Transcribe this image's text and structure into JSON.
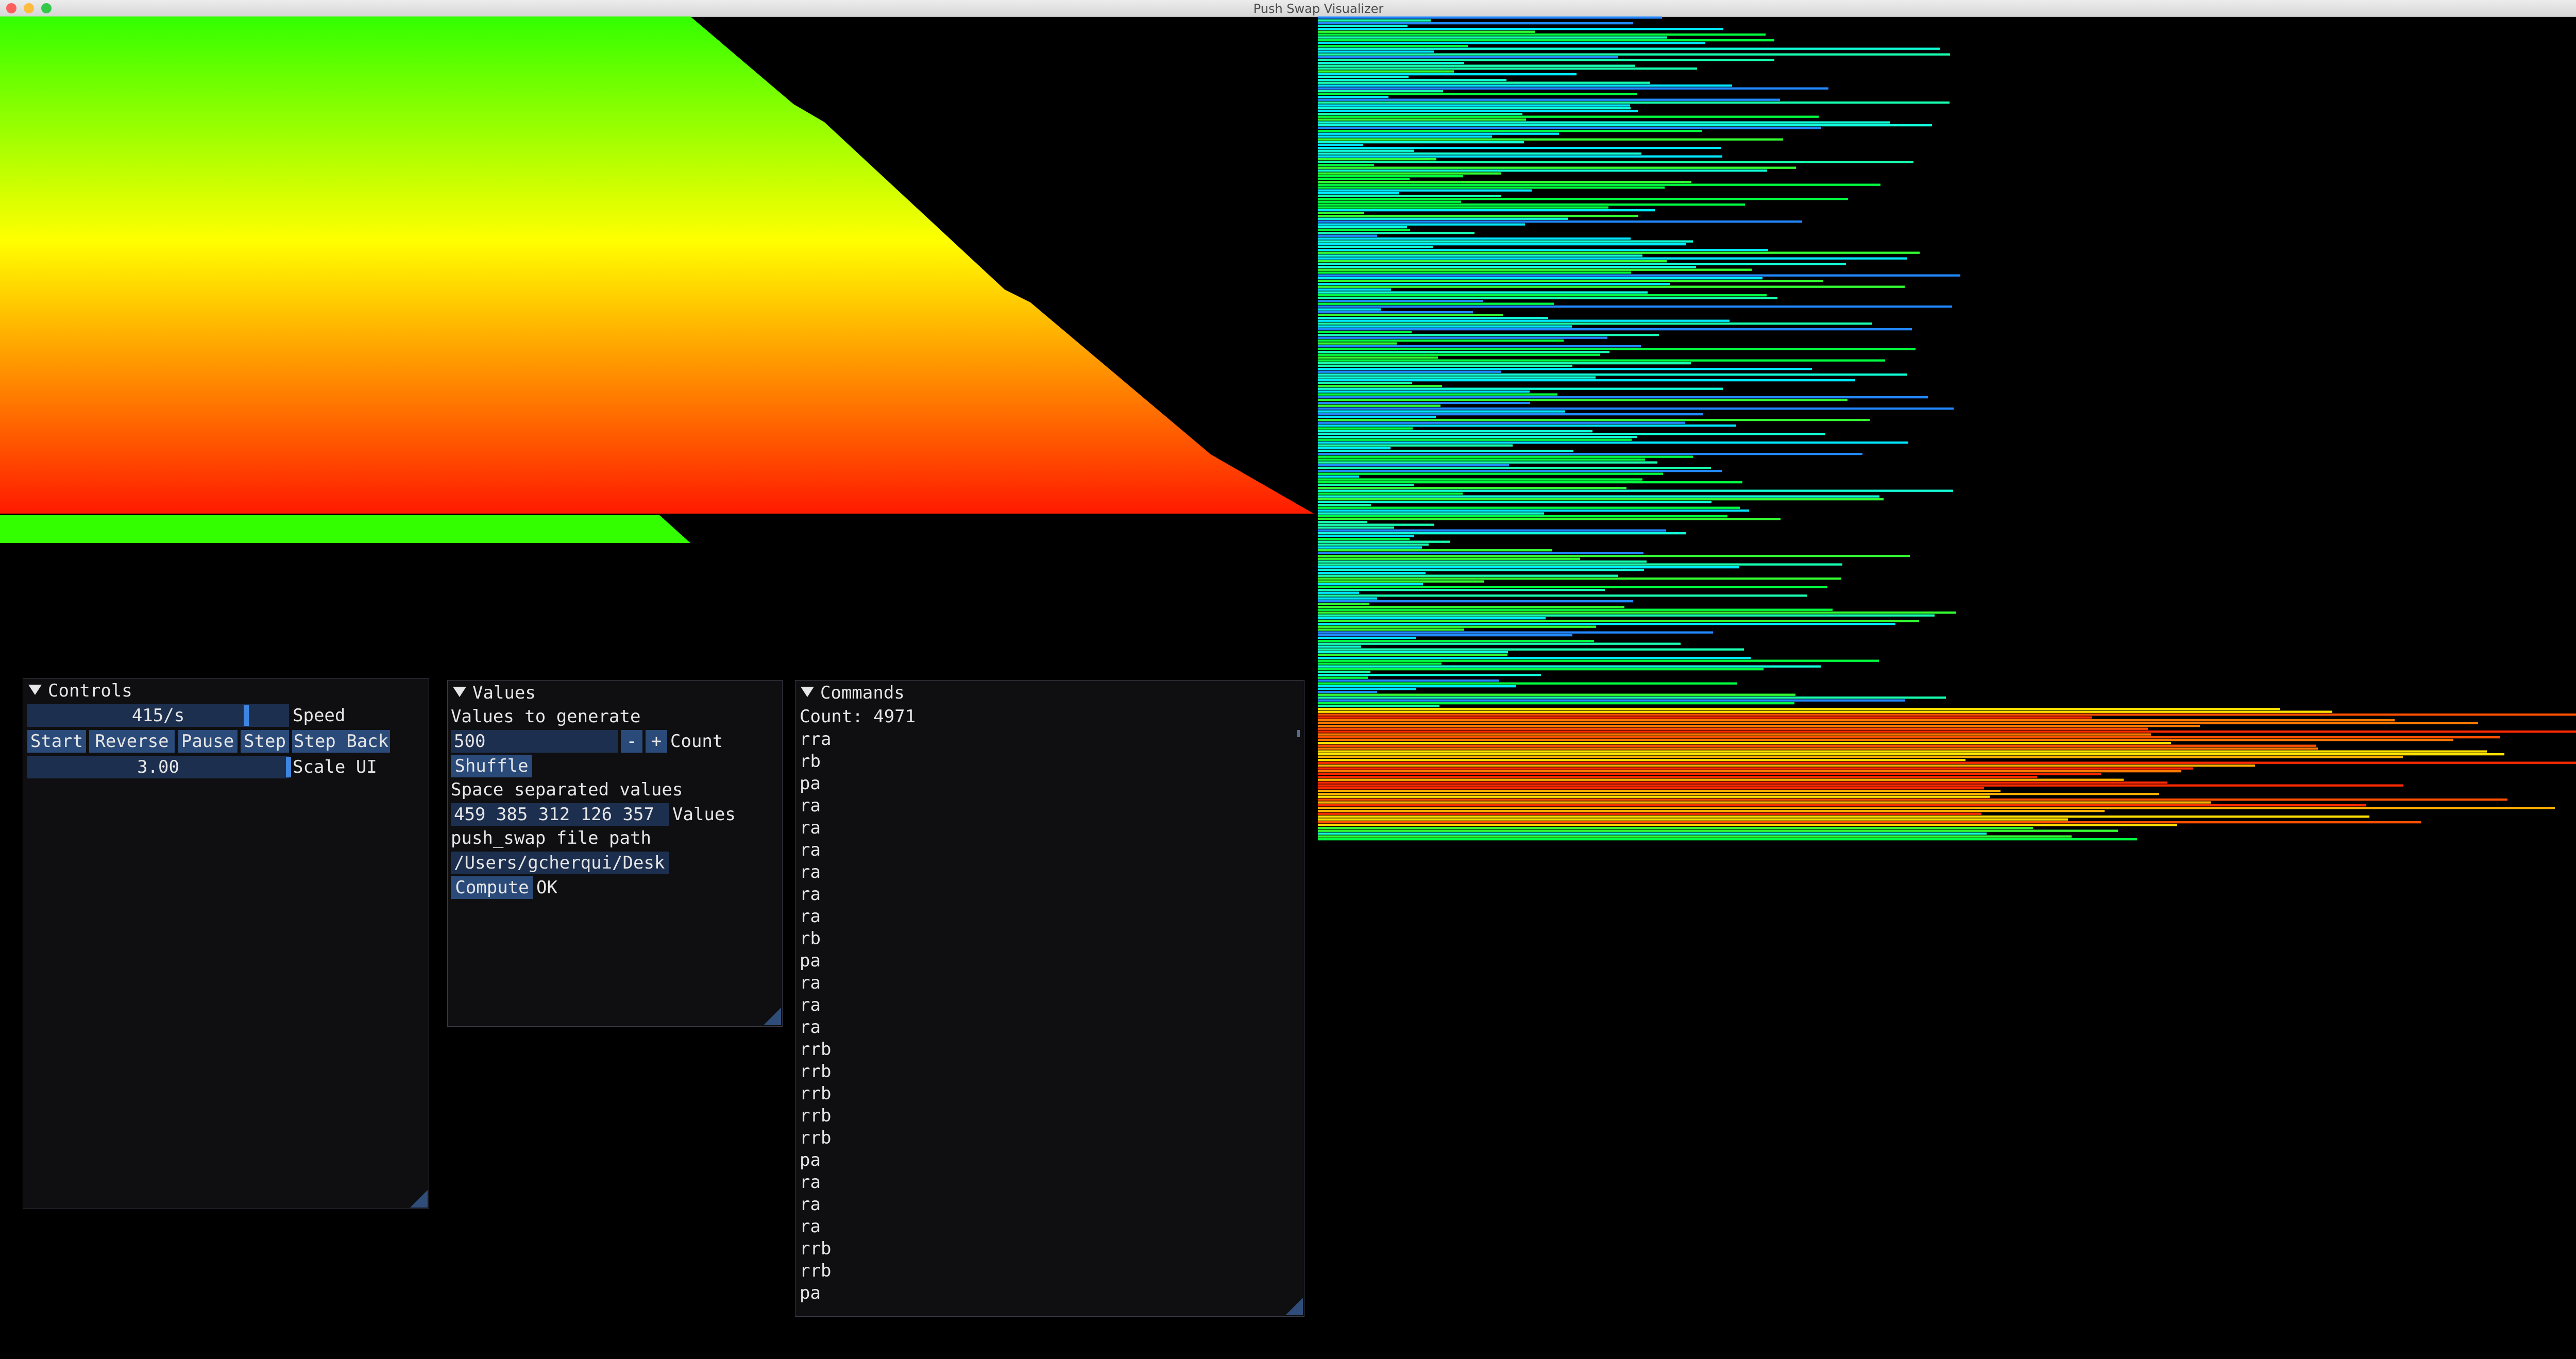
{
  "window": {
    "title": "Push Swap Visualizer",
    "traffic_lights": [
      "#fc605c",
      "#fdbc40",
      "#34c84a"
    ]
  },
  "visualizer": {
    "stack_a_colors": [
      "#00ff00",
      "#ffff00",
      "#ff0000"
    ],
    "stack_b_colors": [
      "#1060ff",
      "#00ffff",
      "#00ff40"
    ]
  },
  "controls": {
    "title": "Controls",
    "speed_value": "415/s",
    "speed_label": "Speed",
    "buttons": [
      "Start",
      "Reverse",
      "Pause",
      "Step",
      "Step Back"
    ],
    "scale_value": "3.00",
    "scale_label": "Scale UI"
  },
  "values": {
    "title": "Values",
    "generate_label": "Values to generate",
    "count_value": "500",
    "minus": "-",
    "plus": "+",
    "count_label": "Count",
    "shuffle_label": "Shuffle",
    "space_label": "Space separated values",
    "values_field": "459 385 312 126 357",
    "values_label": "Values",
    "path_label": "push_swap file path",
    "path_field": "/Users/gcherqui/Desk",
    "compute_label": "Compute",
    "status": "OK"
  },
  "commands": {
    "title": "Commands",
    "count_text": "Count: 4971",
    "items": [
      "rra",
      "rb",
      "pa",
      "ra",
      "ra",
      "ra",
      "ra",
      "ra",
      "ra",
      "rb",
      "pa",
      "ra",
      "ra",
      "ra",
      "rrb",
      "rrb",
      "rrb",
      "rrb",
      "rrb",
      "pa",
      "ra",
      "ra",
      "ra",
      "rrb",
      "rrb",
      "pa"
    ]
  }
}
